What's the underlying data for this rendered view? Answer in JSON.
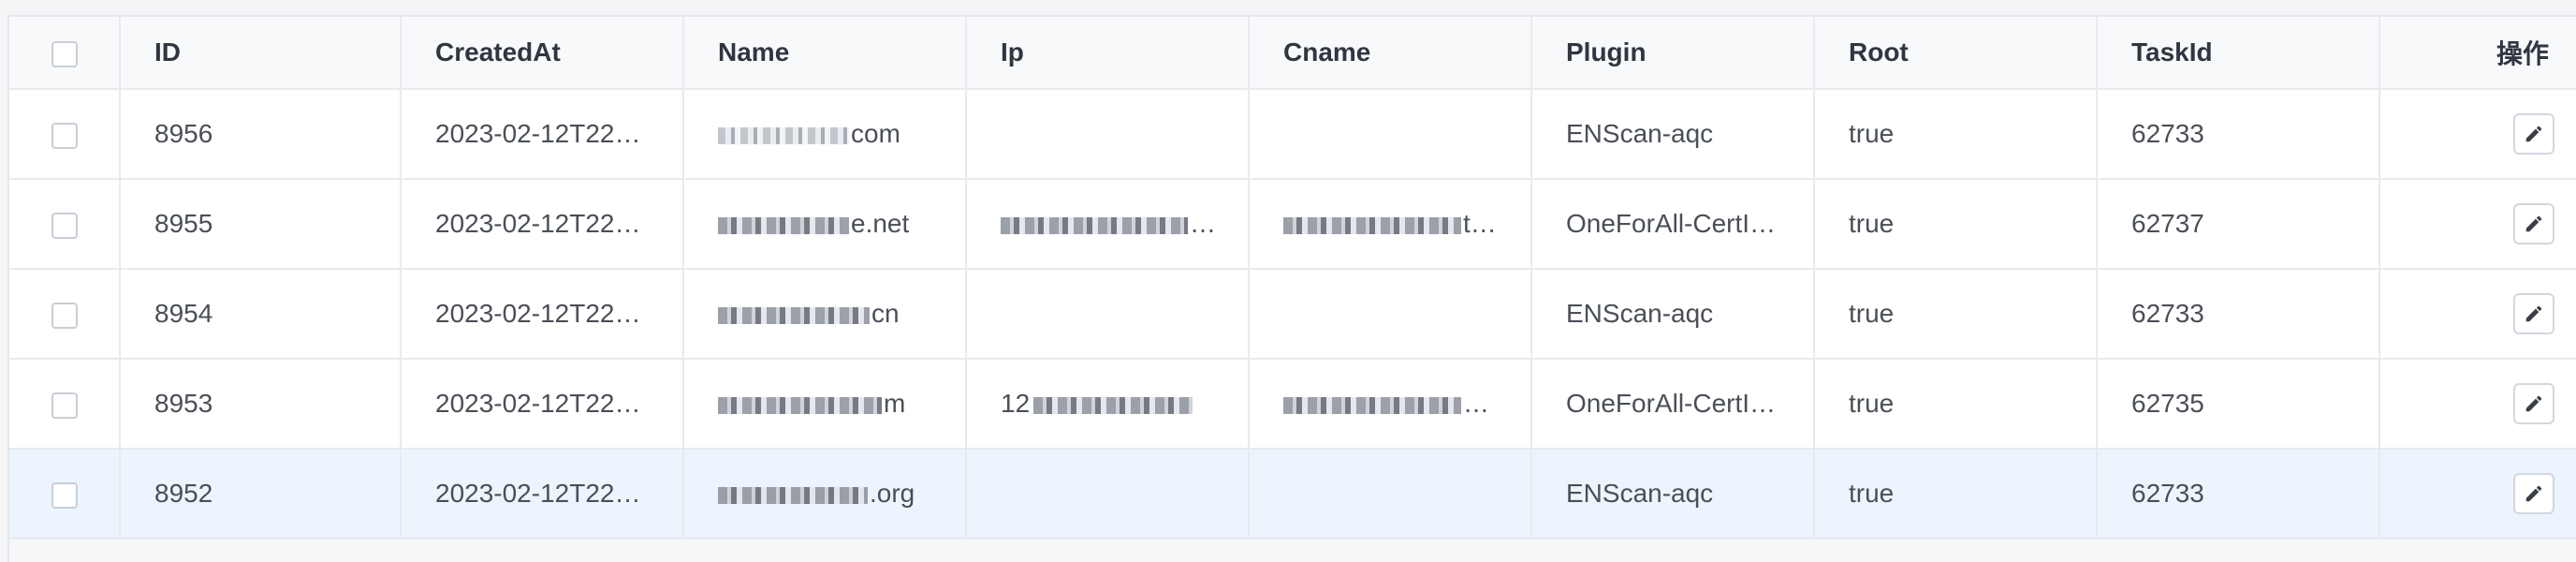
{
  "table": {
    "columns": [
      "ID",
      "CreatedAt",
      "Name",
      "Ip",
      "Cname",
      "Plugin",
      "Root",
      "TaskId",
      "操作"
    ],
    "rows": [
      {
        "id": "8956",
        "created_at": "2023-02-12T22…",
        "name_suffix": "com",
        "ip": "",
        "cname": "",
        "plugin": "ENScan-aqc",
        "root": "true",
        "task_id": "62733"
      },
      {
        "id": "8955",
        "created_at": "2023-02-12T22…",
        "name_suffix": "e.net",
        "ip": "…",
        "cname": "t,…",
        "plugin": "OneForAll-CertI…",
        "root": "true",
        "task_id": "62737"
      },
      {
        "id": "8954",
        "created_at": "2023-02-12T22…",
        "name_suffix": "cn",
        "ip": "",
        "cname": "",
        "plugin": "ENScan-aqc",
        "root": "true",
        "task_id": "62733"
      },
      {
        "id": "8953",
        "created_at": "2023-02-12T22…",
        "name_suffix": "m",
        "ip": "12",
        "cname": "om…",
        "plugin": "OneForAll-CertI…",
        "root": "true",
        "task_id": "62735"
      },
      {
        "id": "8952",
        "created_at": "2023-02-12T22…",
        "name_suffix": ".org",
        "ip": "",
        "cname": "",
        "plugin": "ENScan-aqc",
        "root": "true",
        "task_id": "62733"
      }
    ],
    "selected_row_index": 4,
    "selected_row_color": "#ecf5fd",
    "row_action_icon": "edit-pencil-icon"
  }
}
